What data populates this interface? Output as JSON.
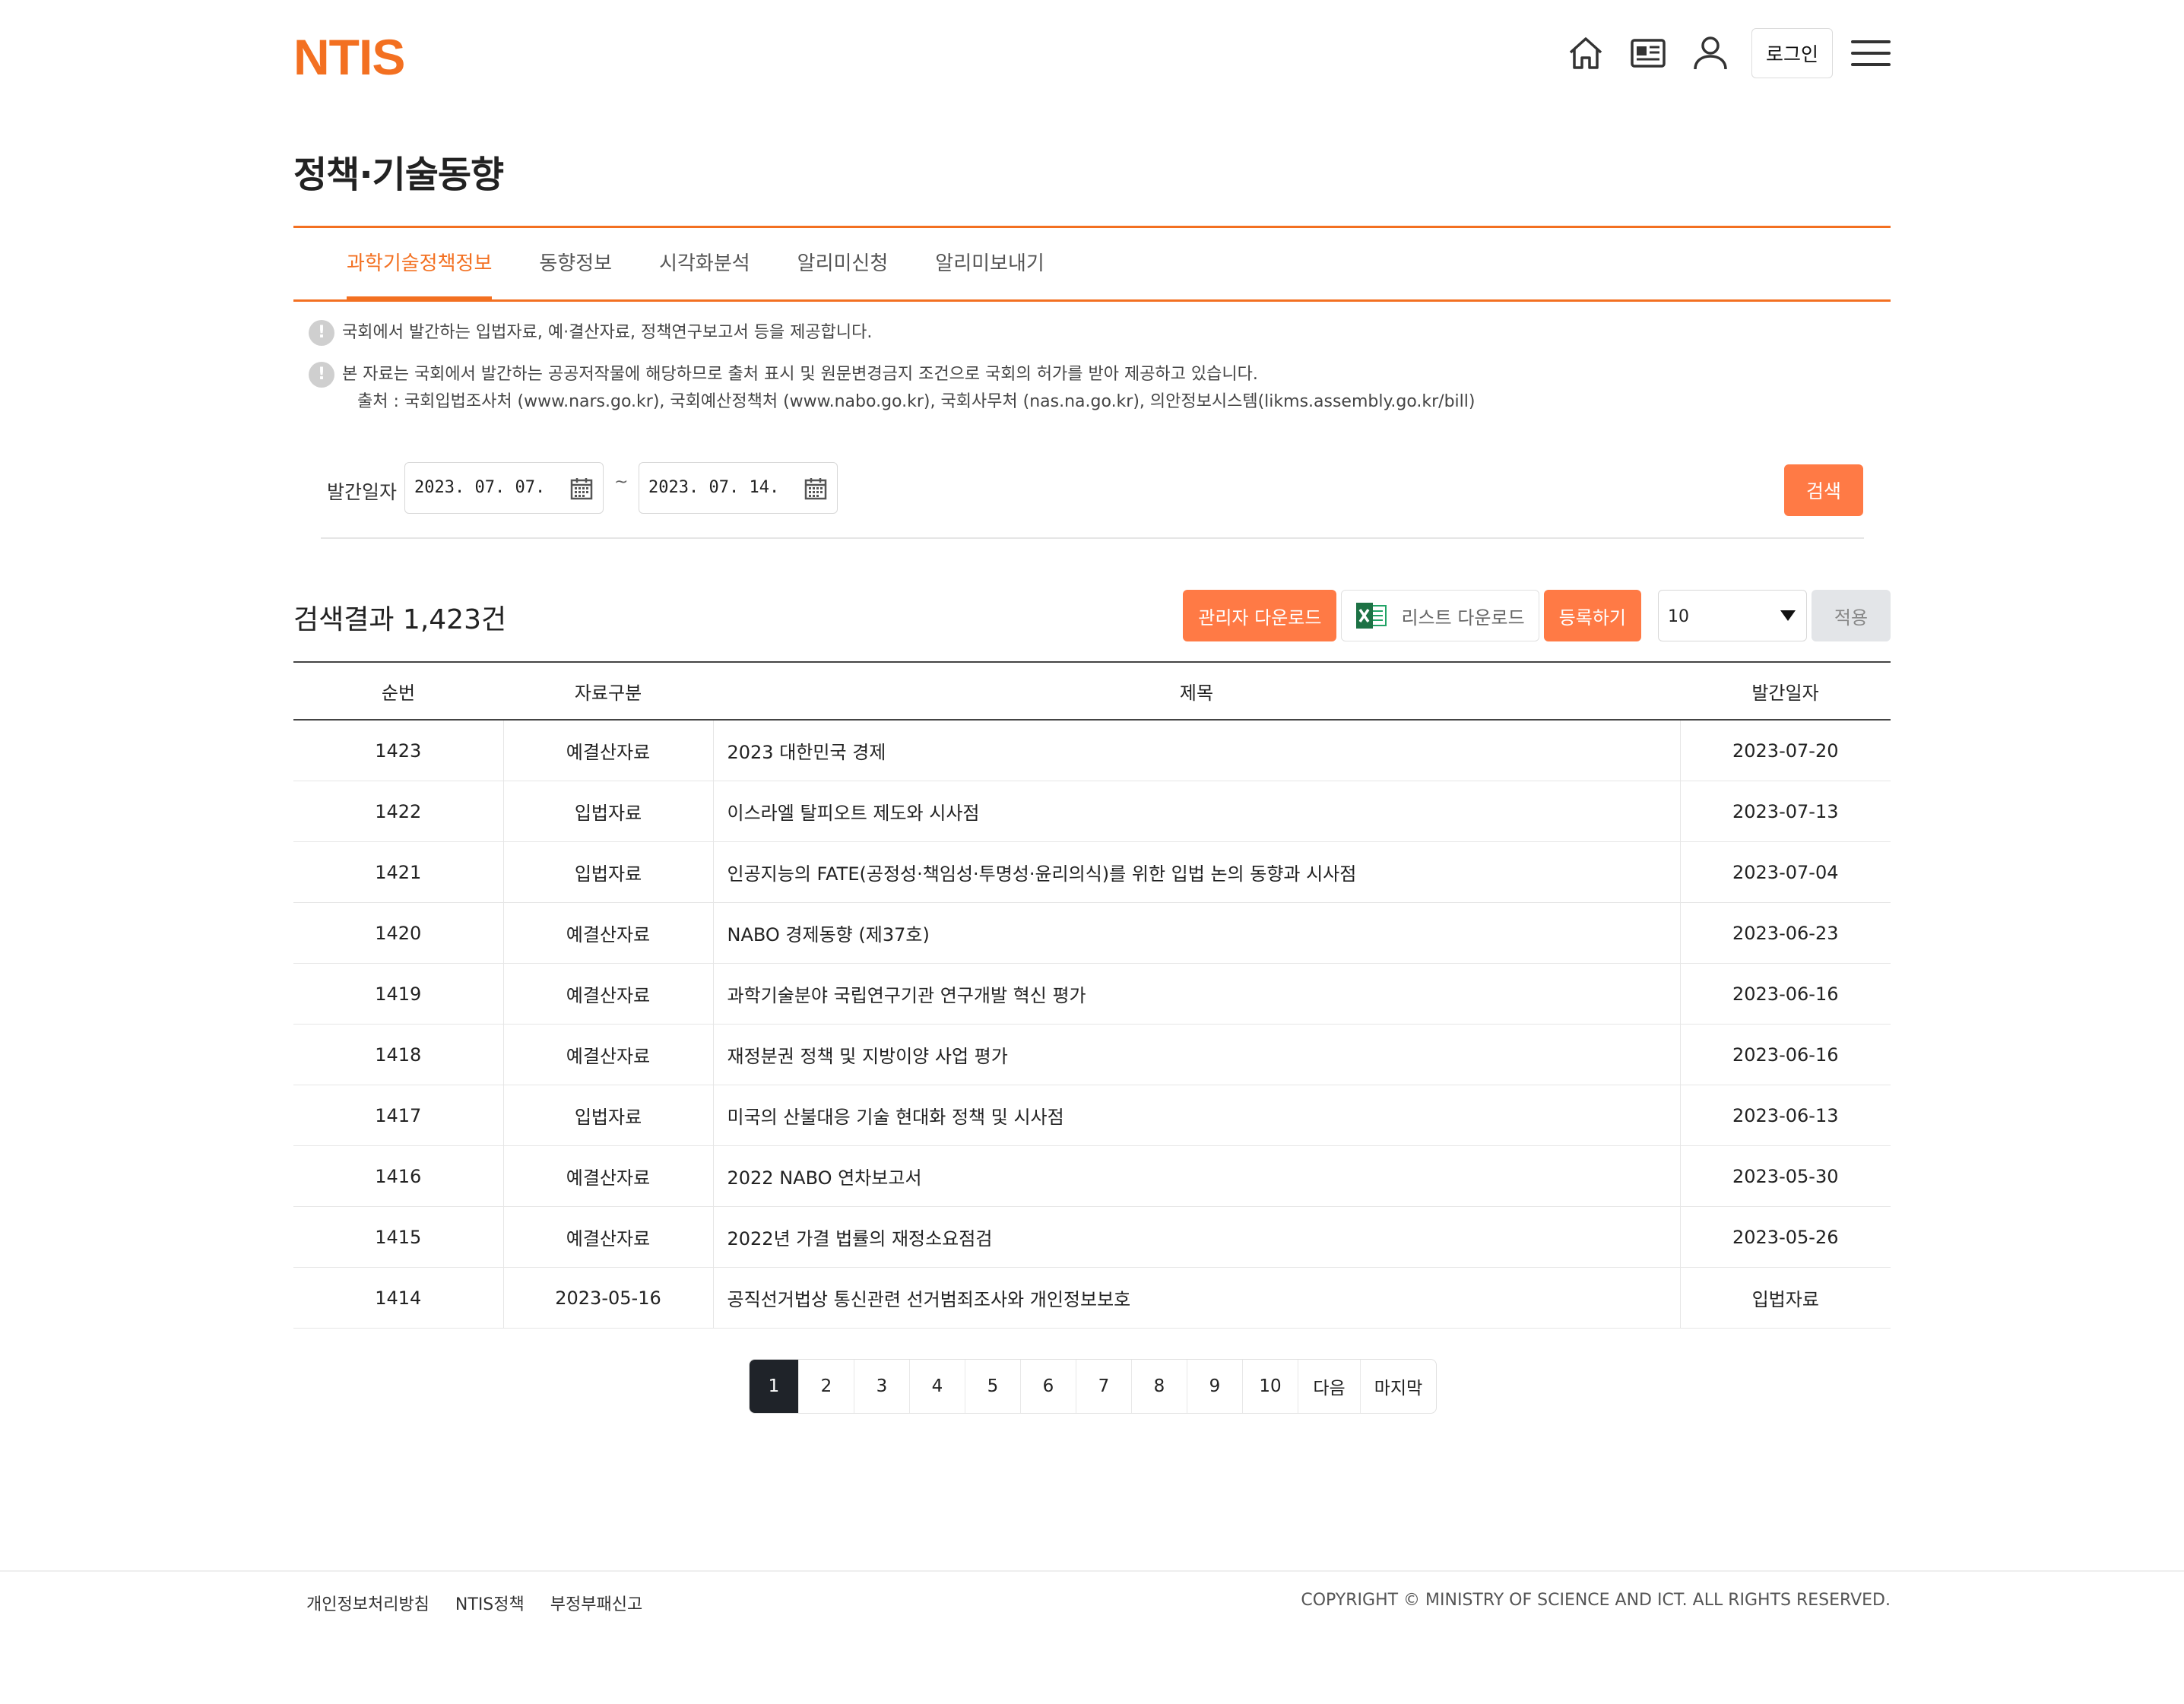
{
  "header": {
    "logo": "NTIS",
    "login_label": "로그인",
    "icons": [
      "home-icon",
      "news-icon",
      "user-icon",
      "menu-icon"
    ]
  },
  "page_title": "정책·기술동향",
  "tabs": [
    {
      "label": "과학기술정책정보",
      "active": true
    },
    {
      "label": "동향정보",
      "active": false
    },
    {
      "label": "시각화분석",
      "active": false
    },
    {
      "label": "알리미신청",
      "active": false
    },
    {
      "label": "알리미보내기",
      "active": false
    }
  ],
  "notices": {
    "line1": "국회에서 발간하는 입법자료, 예·결산자료, 정책연구보고서 등을 제공합니다.",
    "line2": "본 자료는 국회에서 발간하는 공공저작물에 해당하므로 출처 표시 및 원문변경금지 조건으로 국회의 허가를 받아 제공하고 있습니다.",
    "line3": "출처 : 국회입법조사처 (www.nars.go.kr), 국회예산정책처 (www.nabo.go.kr), 국회사무처 (nas.na.go.kr), 의안정보시스템(likms.assembly.go.kr/bill)"
  },
  "search": {
    "date_label": "발간일자",
    "start_date": "2023. 07. 07.",
    "end_date": "2023. 07. 14.",
    "separator": "~",
    "search_button": "검색"
  },
  "results": {
    "title": "검색결과 1,423건",
    "admin_download": "관리자 다운로드",
    "list_download": "리스트 다운로드",
    "register": "등록하기",
    "page_size": "10",
    "apply": "적용"
  },
  "table": {
    "headers": [
      "순번",
      "자료구분",
      "제목",
      "발간일자"
    ],
    "rows": [
      [
        "1423",
        "예결산자료",
        "2023 대한민국 경제",
        "2023-07-20"
      ],
      [
        "1422",
        "입법자료",
        "이스라엘 탈피오트 제도와 시사점",
        "2023-07-13"
      ],
      [
        "1421",
        "입법자료",
        "인공지능의 FATE(공정성·책임성·투명성·윤리의식)를 위한 입법 논의 동향과 시사점",
        "2023-07-04"
      ],
      [
        "1420",
        "예결산자료",
        "NABO 경제동향 (제37호)",
        "2023-06-23"
      ],
      [
        "1419",
        "예결산자료",
        "과학기술분야 국립연구기관 연구개발 혁신 평가",
        "2023-06-16"
      ],
      [
        "1418",
        "예결산자료",
        "재정분권 정책 및 지방이양 사업 평가",
        "2023-06-16"
      ],
      [
        "1417",
        "입법자료",
        "미국의 산불대응 기술 현대화 정책 및 시사점",
        "2023-06-13"
      ],
      [
        "1416",
        "예결산자료",
        "2022 NABO 연차보고서",
        "2023-05-30"
      ],
      [
        "1415",
        "예결산자료",
        "2022년 가결 법률의 재정소요점검",
        "2023-05-26"
      ],
      [
        "1414",
        "2023-05-16",
        "공직선거법상 통신관련 선거범죄조사와 개인정보보호",
        "입법자료"
      ]
    ]
  },
  "pagination": {
    "pages": [
      "1",
      "2",
      "3",
      "4",
      "5",
      "6",
      "7",
      "8",
      "9",
      "10"
    ],
    "next": "다음",
    "last": "마지막",
    "current": "1"
  },
  "footer": {
    "links": [
      "개인정보처리방침",
      "NTIS정책",
      "부정부패신고"
    ],
    "copyright": "COPYRIGHT © MINISTRY OF SCIENCE AND ICT. ALL RIGHTS RESERVED."
  },
  "colors": {
    "accent": "#f37021",
    "button": "#ff7a45",
    "active_page": "#1f2329"
  }
}
